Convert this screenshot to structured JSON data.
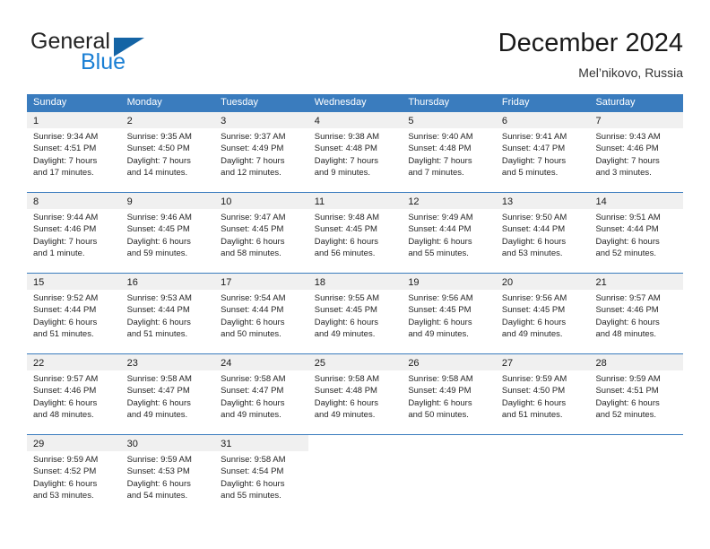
{
  "brand": {
    "name_part1": "General",
    "name_part2": "Blue",
    "triangle_color": "#1464a5",
    "blue_color": "#1a7fd4"
  },
  "header": {
    "title": "December 2024",
    "subtitle": "Mel’nikovo, Russia",
    "header_band_color": "#3a7cbe",
    "day_band_color": "#f0f0f0"
  },
  "weekdays": [
    "Sunday",
    "Monday",
    "Tuesday",
    "Wednesday",
    "Thursday",
    "Friday",
    "Saturday"
  ],
  "weeks": [
    [
      {
        "day": "1",
        "sunrise": "Sunrise: 9:34 AM",
        "sunset": "Sunset: 4:51 PM",
        "daylight1": "Daylight: 7 hours",
        "daylight2": "and 17 minutes."
      },
      {
        "day": "2",
        "sunrise": "Sunrise: 9:35 AM",
        "sunset": "Sunset: 4:50 PM",
        "daylight1": "Daylight: 7 hours",
        "daylight2": "and 14 minutes."
      },
      {
        "day": "3",
        "sunrise": "Sunrise: 9:37 AM",
        "sunset": "Sunset: 4:49 PM",
        "daylight1": "Daylight: 7 hours",
        "daylight2": "and 12 minutes."
      },
      {
        "day": "4",
        "sunrise": "Sunrise: 9:38 AM",
        "sunset": "Sunset: 4:48 PM",
        "daylight1": "Daylight: 7 hours",
        "daylight2": "and 9 minutes."
      },
      {
        "day": "5",
        "sunrise": "Sunrise: 9:40 AM",
        "sunset": "Sunset: 4:48 PM",
        "daylight1": "Daylight: 7 hours",
        "daylight2": "and 7 minutes."
      },
      {
        "day": "6",
        "sunrise": "Sunrise: 9:41 AM",
        "sunset": "Sunset: 4:47 PM",
        "daylight1": "Daylight: 7 hours",
        "daylight2": "and 5 minutes."
      },
      {
        "day": "7",
        "sunrise": "Sunrise: 9:43 AM",
        "sunset": "Sunset: 4:46 PM",
        "daylight1": "Daylight: 7 hours",
        "daylight2": "and 3 minutes."
      }
    ],
    [
      {
        "day": "8",
        "sunrise": "Sunrise: 9:44 AM",
        "sunset": "Sunset: 4:46 PM",
        "daylight1": "Daylight: 7 hours",
        "daylight2": "and 1 minute."
      },
      {
        "day": "9",
        "sunrise": "Sunrise: 9:46 AM",
        "sunset": "Sunset: 4:45 PM",
        "daylight1": "Daylight: 6 hours",
        "daylight2": "and 59 minutes."
      },
      {
        "day": "10",
        "sunrise": "Sunrise: 9:47 AM",
        "sunset": "Sunset: 4:45 PM",
        "daylight1": "Daylight: 6 hours",
        "daylight2": "and 58 minutes."
      },
      {
        "day": "11",
        "sunrise": "Sunrise: 9:48 AM",
        "sunset": "Sunset: 4:45 PM",
        "daylight1": "Daylight: 6 hours",
        "daylight2": "and 56 minutes."
      },
      {
        "day": "12",
        "sunrise": "Sunrise: 9:49 AM",
        "sunset": "Sunset: 4:44 PM",
        "daylight1": "Daylight: 6 hours",
        "daylight2": "and 55 minutes."
      },
      {
        "day": "13",
        "sunrise": "Sunrise: 9:50 AM",
        "sunset": "Sunset: 4:44 PM",
        "daylight1": "Daylight: 6 hours",
        "daylight2": "and 53 minutes."
      },
      {
        "day": "14",
        "sunrise": "Sunrise: 9:51 AM",
        "sunset": "Sunset: 4:44 PM",
        "daylight1": "Daylight: 6 hours",
        "daylight2": "and 52 minutes."
      }
    ],
    [
      {
        "day": "15",
        "sunrise": "Sunrise: 9:52 AM",
        "sunset": "Sunset: 4:44 PM",
        "daylight1": "Daylight: 6 hours",
        "daylight2": "and 51 minutes."
      },
      {
        "day": "16",
        "sunrise": "Sunrise: 9:53 AM",
        "sunset": "Sunset: 4:44 PM",
        "daylight1": "Daylight: 6 hours",
        "daylight2": "and 51 minutes."
      },
      {
        "day": "17",
        "sunrise": "Sunrise: 9:54 AM",
        "sunset": "Sunset: 4:44 PM",
        "daylight1": "Daylight: 6 hours",
        "daylight2": "and 50 minutes."
      },
      {
        "day": "18",
        "sunrise": "Sunrise: 9:55 AM",
        "sunset": "Sunset: 4:45 PM",
        "daylight1": "Daylight: 6 hours",
        "daylight2": "and 49 minutes."
      },
      {
        "day": "19",
        "sunrise": "Sunrise: 9:56 AM",
        "sunset": "Sunset: 4:45 PM",
        "daylight1": "Daylight: 6 hours",
        "daylight2": "and 49 minutes."
      },
      {
        "day": "20",
        "sunrise": "Sunrise: 9:56 AM",
        "sunset": "Sunset: 4:45 PM",
        "daylight1": "Daylight: 6 hours",
        "daylight2": "and 49 minutes."
      },
      {
        "day": "21",
        "sunrise": "Sunrise: 9:57 AM",
        "sunset": "Sunset: 4:46 PM",
        "daylight1": "Daylight: 6 hours",
        "daylight2": "and 48 minutes."
      }
    ],
    [
      {
        "day": "22",
        "sunrise": "Sunrise: 9:57 AM",
        "sunset": "Sunset: 4:46 PM",
        "daylight1": "Daylight: 6 hours",
        "daylight2": "and 48 minutes."
      },
      {
        "day": "23",
        "sunrise": "Sunrise: 9:58 AM",
        "sunset": "Sunset: 4:47 PM",
        "daylight1": "Daylight: 6 hours",
        "daylight2": "and 49 minutes."
      },
      {
        "day": "24",
        "sunrise": "Sunrise: 9:58 AM",
        "sunset": "Sunset: 4:47 PM",
        "daylight1": "Daylight: 6 hours",
        "daylight2": "and 49 minutes."
      },
      {
        "day": "25",
        "sunrise": "Sunrise: 9:58 AM",
        "sunset": "Sunset: 4:48 PM",
        "daylight1": "Daylight: 6 hours",
        "daylight2": "and 49 minutes."
      },
      {
        "day": "26",
        "sunrise": "Sunrise: 9:58 AM",
        "sunset": "Sunset: 4:49 PM",
        "daylight1": "Daylight: 6 hours",
        "daylight2": "and 50 minutes."
      },
      {
        "day": "27",
        "sunrise": "Sunrise: 9:59 AM",
        "sunset": "Sunset: 4:50 PM",
        "daylight1": "Daylight: 6 hours",
        "daylight2": "and 51 minutes."
      },
      {
        "day": "28",
        "sunrise": "Sunrise: 9:59 AM",
        "sunset": "Sunset: 4:51 PM",
        "daylight1": "Daylight: 6 hours",
        "daylight2": "and 52 minutes."
      }
    ],
    [
      {
        "day": "29",
        "sunrise": "Sunrise: 9:59 AM",
        "sunset": "Sunset: 4:52 PM",
        "daylight1": "Daylight: 6 hours",
        "daylight2": "and 53 minutes."
      },
      {
        "day": "30",
        "sunrise": "Sunrise: 9:59 AM",
        "sunset": "Sunset: 4:53 PM",
        "daylight1": "Daylight: 6 hours",
        "daylight2": "and 54 minutes."
      },
      {
        "day": "31",
        "sunrise": "Sunrise: 9:58 AM",
        "sunset": "Sunset: 4:54 PM",
        "daylight1": "Daylight: 6 hours",
        "daylight2": "and 55 minutes."
      },
      {
        "day": "",
        "sunrise": "",
        "sunset": "",
        "daylight1": "",
        "daylight2": ""
      },
      {
        "day": "",
        "sunrise": "",
        "sunset": "",
        "daylight1": "",
        "daylight2": ""
      },
      {
        "day": "",
        "sunrise": "",
        "sunset": "",
        "daylight1": "",
        "daylight2": ""
      },
      {
        "day": "",
        "sunrise": "",
        "sunset": "",
        "daylight1": "",
        "daylight2": ""
      }
    ]
  ]
}
